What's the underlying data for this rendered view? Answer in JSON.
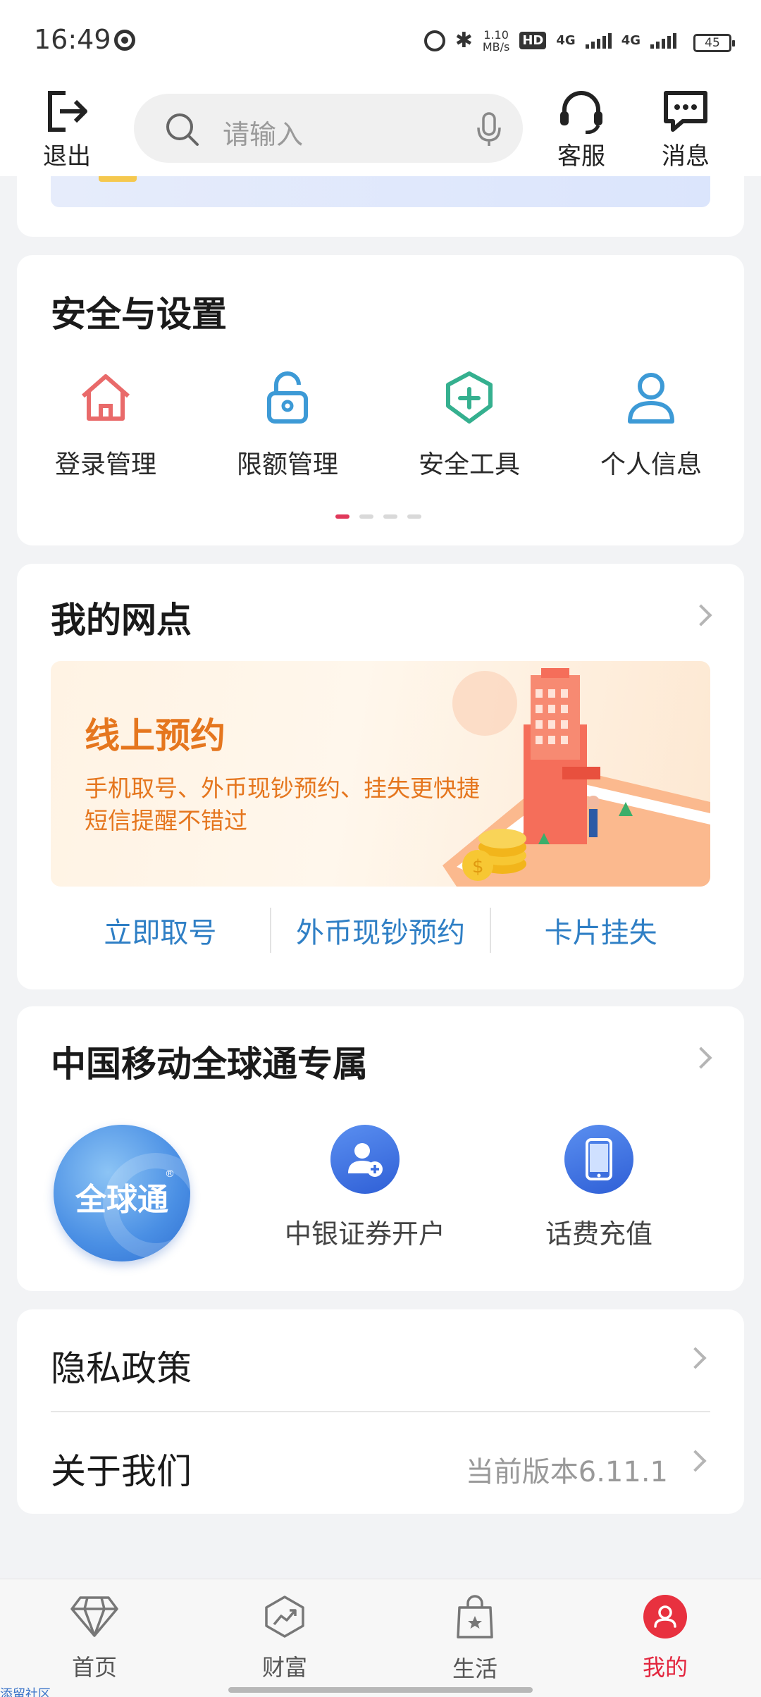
{
  "status_bar": {
    "time": "16:49",
    "net_speed_value": "1.10",
    "net_speed_unit": "MB/s",
    "hd_label": "HD",
    "signal_1": "4G",
    "signal_2": "4G",
    "battery": "45"
  },
  "top_nav": {
    "logout_label": "退出",
    "search_placeholder": "请输入",
    "service_label": "客服",
    "message_label": "消息"
  },
  "security": {
    "title": "安全与设置",
    "items": [
      {
        "label": "登录管理",
        "icon": "house-icon",
        "color": "#e96a6a"
      },
      {
        "label": "限额管理",
        "icon": "lock-icon",
        "color": "#3d9ad6"
      },
      {
        "label": "安全工具",
        "icon": "shield-plus-icon",
        "color": "#35b08f"
      },
      {
        "label": "个人信息",
        "icon": "person-icon",
        "color": "#3d9ad6"
      }
    ],
    "page_count": 4,
    "active_page": 1
  },
  "branch": {
    "title": "我的网点",
    "banner_title": "线上预约",
    "banner_line1": "手机取号、外币现钞预约、挂失更快捷",
    "banner_line2": "短信提醒不错过",
    "actions": [
      "立即取号",
      "外币现钞预约",
      "卡片挂失"
    ]
  },
  "cmcc": {
    "title": "中国移动全球通专属",
    "logo_text": "全球通",
    "items": [
      {
        "label": "中银证券开户",
        "icon": "user-add-icon"
      },
      {
        "label": "话费充值",
        "icon": "phone-icon"
      }
    ]
  },
  "about": {
    "privacy_label": "隐私政策",
    "about_label": "关于我们",
    "version_text": "当前版本6.11.1"
  },
  "tab_bar": {
    "tabs": [
      {
        "label": "首页",
        "icon": "diamond-icon"
      },
      {
        "label": "财富",
        "icon": "chart-up-icon"
      },
      {
        "label": "生活",
        "icon": "bag-star-icon"
      },
      {
        "label": "我的",
        "icon": "user-icon"
      }
    ],
    "active_tab": "我的",
    "active_color": "#e3263e"
  },
  "watermark": "添留社区"
}
